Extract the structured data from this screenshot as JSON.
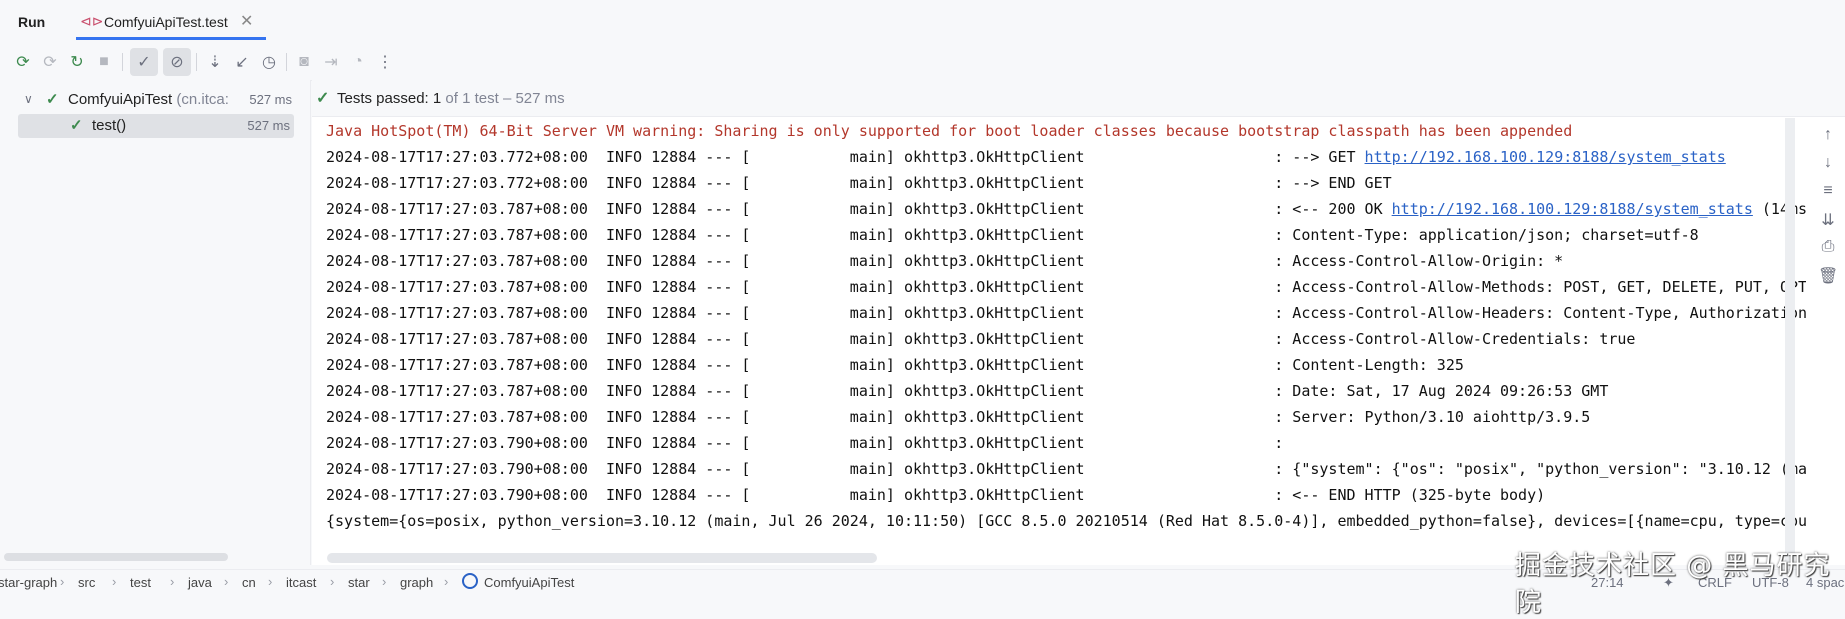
{
  "tab_bar": {
    "run_label": "Run",
    "tab_label": "ComfyuiApiTest.test",
    "tab_icon": "run-config-icon",
    "close_icon": "close-icon"
  },
  "toolbar": {
    "buttons": [
      "rerun-icon",
      "rerun-failed-icon",
      "toggle-auto-test-icon",
      "stop-icon",
      "show-passed-icon",
      "show-ignored-icon",
      "sort-icon",
      "collapse-icon",
      "history-icon",
      "screenshot-icon",
      "import-icon",
      "export-icon",
      "more-icon"
    ]
  },
  "tree": {
    "root_name": "ComfyuiApiTest",
    "root_package": "(cn.itca:",
    "root_time": "527 ms",
    "child_name": "test()",
    "child_time": "527 ms"
  },
  "status": {
    "prefix": "Tests passed:",
    "passed": "1",
    "suffix": "of 1 test – 527 ms"
  },
  "console": {
    "warning": "Java HotSpot(TM) 64-Bit Server VM warning: Sharing is only supported for boot loader classes because bootstrap classpath has been appended",
    "lines": [
      {
        "prefix": "2024-08-17T17:27:03.772+08:00  INFO 12884 --- [           main] okhttp3.OkHttpClient                     : --> GET ",
        "link": "http://192.168.100.129:8188/system_stats",
        "suffix": ""
      },
      {
        "prefix": "2024-08-17T17:27:03.772+08:00  INFO 12884 --- [           main] okhttp3.OkHttpClient                     : --> END GET",
        "link": "",
        "suffix": ""
      },
      {
        "prefix": "2024-08-17T17:27:03.787+08:00  INFO 12884 --- [           main] okhttp3.OkHttpClient                     : <-- 200 OK ",
        "link": "http://192.168.100.129:8188/system_stats",
        "suffix": " (14ms"
      },
      {
        "prefix": "2024-08-17T17:27:03.787+08:00  INFO 12884 --- [           main] okhttp3.OkHttpClient                     : Content-Type: application/json; charset=utf-8",
        "link": "",
        "suffix": ""
      },
      {
        "prefix": "2024-08-17T17:27:03.787+08:00  INFO 12884 --- [           main] okhttp3.OkHttpClient                     : Access-Control-Allow-Origin: *",
        "link": "",
        "suffix": ""
      },
      {
        "prefix": "2024-08-17T17:27:03.787+08:00  INFO 12884 --- [           main] okhttp3.OkHttpClient                     : Access-Control-Allow-Methods: POST, GET, DELETE, PUT, OPT",
        "link": "",
        "suffix": ""
      },
      {
        "prefix": "2024-08-17T17:27:03.787+08:00  INFO 12884 --- [           main] okhttp3.OkHttpClient                     : Access-Control-Allow-Headers: Content-Type, Authorization",
        "link": "",
        "suffix": ""
      },
      {
        "prefix": "2024-08-17T17:27:03.787+08:00  INFO 12884 --- [           main] okhttp3.OkHttpClient                     : Access-Control-Allow-Credentials: true",
        "link": "",
        "suffix": ""
      },
      {
        "prefix": "2024-08-17T17:27:03.787+08:00  INFO 12884 --- [           main] okhttp3.OkHttpClient                     : Content-Length: 325",
        "link": "",
        "suffix": ""
      },
      {
        "prefix": "2024-08-17T17:27:03.787+08:00  INFO 12884 --- [           main] okhttp3.OkHttpClient                     : Date: Sat, 17 Aug 2024 09:26:53 GMT",
        "link": "",
        "suffix": ""
      },
      {
        "prefix": "2024-08-17T17:27:03.787+08:00  INFO 12884 --- [           main] okhttp3.OkHttpClient                     : Server: Python/3.10 aiohttp/3.9.5",
        "link": "",
        "suffix": ""
      },
      {
        "prefix": "2024-08-17T17:27:03.790+08:00  INFO 12884 --- [           main] okhttp3.OkHttpClient                     :",
        "link": "",
        "suffix": ""
      },
      {
        "prefix": "2024-08-17T17:27:03.790+08:00  INFO 12884 --- [           main] okhttp3.OkHttpClient                     : {\"system\": {\"os\": \"posix\", \"python_version\": \"3.10.12 (ma",
        "link": "",
        "suffix": ""
      },
      {
        "prefix": "2024-08-17T17:27:03.790+08:00  INFO 12884 --- [           main] okhttp3.OkHttpClient                     : <-- END HTTP (325-byte body)",
        "link": "",
        "suffix": ""
      },
      {
        "prefix": "{system={os=posix, python_version=3.10.12 (main, Jul 26 2024, 10:11:50) [GCC 8.5.0 20210514 (Red Hat 8.5.0-4)], embedded_python=false}, devices=[{name=cpu, type=cpu",
        "link": "",
        "suffix": ""
      }
    ]
  },
  "right_tools": [
    "up-arrow-icon",
    "down-arrow-icon",
    "soft-wrap-icon",
    "scroll-to-end-icon",
    "print-icon",
    "trash-icon"
  ],
  "breadcrumb": {
    "items": [
      "star-graph",
      "src",
      "test",
      "java",
      "cn",
      "itcast",
      "star",
      "graph"
    ],
    "last": "ComfyuiApiTest"
  },
  "status_bar": {
    "position": "27:14",
    "line_sep": "CRLF",
    "encoding": "UTF-8",
    "indent": "4 spac"
  },
  "watermark": "掘金技术社区 @ 黑马研究院"
}
